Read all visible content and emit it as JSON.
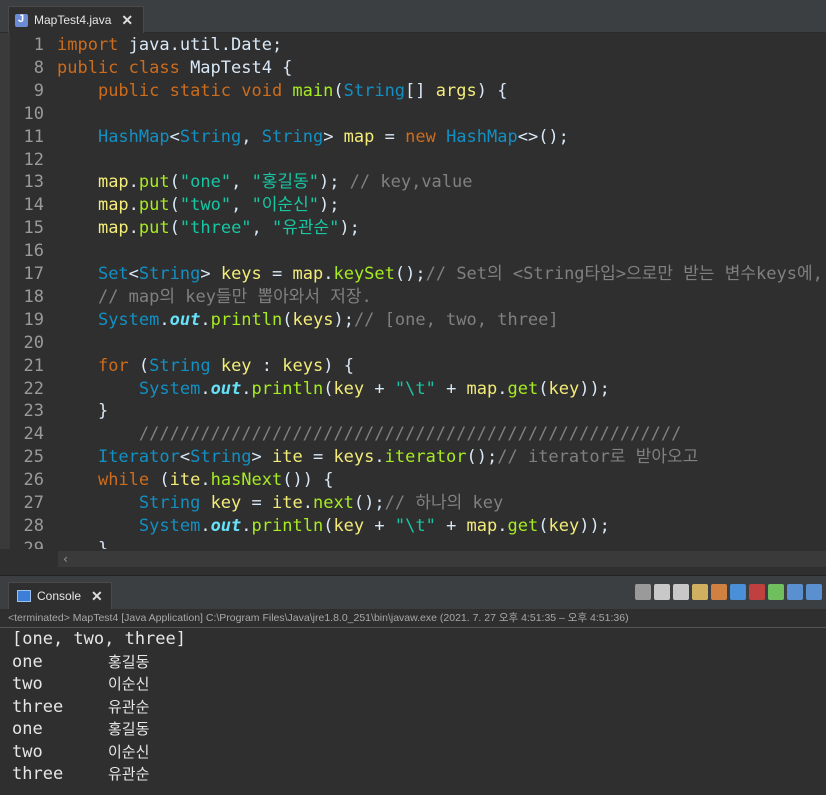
{
  "editor": {
    "tab_title": "MapTest4.java",
    "lines": [
      {
        "n": "1",
        "tokens": [
          {
            "c": "kw",
            "t": "import "
          },
          {
            "c": "",
            "t": "java.util.Date;"
          }
        ]
      },
      {
        "n": "8",
        "tokens": [
          {
            "c": "kw",
            "t": "public class "
          },
          {
            "c": "",
            "t": "MapTest4 {"
          }
        ]
      },
      {
        "n": "9",
        "tokens": [
          {
            "c": "",
            "t": "    "
          },
          {
            "c": "kw",
            "t": "public static void "
          },
          {
            "c": "fn",
            "t": "main"
          },
          {
            "c": "",
            "t": "("
          },
          {
            "c": "ty",
            "t": "String"
          },
          {
            "c": "",
            "t": "[] "
          },
          {
            "c": "vr",
            "t": "args"
          },
          {
            "c": "",
            "t": ") {"
          }
        ]
      },
      {
        "n": "10",
        "tokens": []
      },
      {
        "n": "11",
        "tokens": [
          {
            "c": "",
            "t": "    "
          },
          {
            "c": "ty",
            "t": "HashMap"
          },
          {
            "c": "",
            "t": "<"
          },
          {
            "c": "ty",
            "t": "String"
          },
          {
            "c": "",
            "t": ", "
          },
          {
            "c": "ty",
            "t": "String"
          },
          {
            "c": "",
            "t": "> "
          },
          {
            "c": "vr",
            "t": "map"
          },
          {
            "c": "",
            "t": " = "
          },
          {
            "c": "kw",
            "t": "new "
          },
          {
            "c": "ty",
            "t": "HashMap"
          },
          {
            "c": "",
            "t": "<>();"
          }
        ]
      },
      {
        "n": "12",
        "tokens": []
      },
      {
        "n": "13",
        "tokens": [
          {
            "c": "",
            "t": "    "
          },
          {
            "c": "vr",
            "t": "map"
          },
          {
            "c": "",
            "t": "."
          },
          {
            "c": "fn",
            "t": "put"
          },
          {
            "c": "",
            "t": "("
          },
          {
            "c": "str",
            "t": "\"one\""
          },
          {
            "c": "",
            "t": ", "
          },
          {
            "c": "str",
            "t": "\"홍길동\""
          },
          {
            "c": "",
            "t": "); "
          },
          {
            "c": "cm",
            "t": "// key,value"
          }
        ]
      },
      {
        "n": "14",
        "tokens": [
          {
            "c": "",
            "t": "    "
          },
          {
            "c": "vr",
            "t": "map"
          },
          {
            "c": "",
            "t": "."
          },
          {
            "c": "fn",
            "t": "put"
          },
          {
            "c": "",
            "t": "("
          },
          {
            "c": "str",
            "t": "\"two\""
          },
          {
            "c": "",
            "t": ", "
          },
          {
            "c": "str",
            "t": "\"이순신\""
          },
          {
            "c": "",
            "t": ");"
          }
        ]
      },
      {
        "n": "15",
        "tokens": [
          {
            "c": "",
            "t": "    "
          },
          {
            "c": "vr",
            "t": "map"
          },
          {
            "c": "",
            "t": "."
          },
          {
            "c": "fn",
            "t": "put"
          },
          {
            "c": "",
            "t": "("
          },
          {
            "c": "str",
            "t": "\"three\""
          },
          {
            "c": "",
            "t": ", "
          },
          {
            "c": "str",
            "t": "\"유관순\""
          },
          {
            "c": "",
            "t": ");"
          }
        ]
      },
      {
        "n": "16",
        "tokens": []
      },
      {
        "n": "17",
        "tokens": [
          {
            "c": "",
            "t": "    "
          },
          {
            "c": "ty",
            "t": "Set"
          },
          {
            "c": "",
            "t": "<"
          },
          {
            "c": "ty",
            "t": "String"
          },
          {
            "c": "",
            "t": "> "
          },
          {
            "c": "vr",
            "t": "keys"
          },
          {
            "c": "",
            "t": " = "
          },
          {
            "c": "vr",
            "t": "map"
          },
          {
            "c": "",
            "t": "."
          },
          {
            "c": "fn",
            "t": "keySet"
          },
          {
            "c": "",
            "t": "();"
          },
          {
            "c": "cm",
            "t": "// Set의 <String타입>으로만 받는 변수keys에,"
          }
        ]
      },
      {
        "n": "18",
        "tokens": [
          {
            "c": "",
            "t": "    "
          },
          {
            "c": "cm",
            "t": "// map의 key들만 뽑아와서 저장."
          }
        ]
      },
      {
        "n": "19",
        "tokens": [
          {
            "c": "",
            "t": "    "
          },
          {
            "c": "ty",
            "t": "System"
          },
          {
            "c": "",
            "t": "."
          },
          {
            "c": "fld",
            "t": "out"
          },
          {
            "c": "",
            "t": "."
          },
          {
            "c": "fn",
            "t": "println"
          },
          {
            "c": "",
            "t": "("
          },
          {
            "c": "vr",
            "t": "keys"
          },
          {
            "c": "",
            "t": ");"
          },
          {
            "c": "cm",
            "t": "// [one, two, three]"
          }
        ]
      },
      {
        "n": "20",
        "tokens": []
      },
      {
        "n": "21",
        "tokens": [
          {
            "c": "",
            "t": "    "
          },
          {
            "c": "kw",
            "t": "for "
          },
          {
            "c": "",
            "t": "("
          },
          {
            "c": "ty",
            "t": "String"
          },
          {
            "c": "",
            "t": " "
          },
          {
            "c": "vr",
            "t": "key"
          },
          {
            "c": "",
            "t": " : "
          },
          {
            "c": "vr",
            "t": "keys"
          },
          {
            "c": "",
            "t": ") {"
          }
        ]
      },
      {
        "n": "22",
        "tokens": [
          {
            "c": "",
            "t": "        "
          },
          {
            "c": "ty",
            "t": "System"
          },
          {
            "c": "",
            "t": "."
          },
          {
            "c": "fld",
            "t": "out"
          },
          {
            "c": "",
            "t": "."
          },
          {
            "c": "fn",
            "t": "println"
          },
          {
            "c": "",
            "t": "("
          },
          {
            "c": "vr",
            "t": "key"
          },
          {
            "c": "",
            "t": " + "
          },
          {
            "c": "str",
            "t": "\"\\t\""
          },
          {
            "c": "",
            "t": " + "
          },
          {
            "c": "vr",
            "t": "map"
          },
          {
            "c": "",
            "t": "."
          },
          {
            "c": "fn",
            "t": "get"
          },
          {
            "c": "",
            "t": "("
          },
          {
            "c": "vr",
            "t": "key"
          },
          {
            "c": "",
            "t": "));"
          }
        ]
      },
      {
        "n": "23",
        "tokens": [
          {
            "c": "",
            "t": "    }"
          }
        ]
      },
      {
        "n": "24",
        "tokens": [
          {
            "c": "",
            "t": "        "
          },
          {
            "c": "cm",
            "t": "/////////////////////////////////////////////////////"
          }
        ]
      },
      {
        "n": "25",
        "tokens": [
          {
            "c": "",
            "t": "    "
          },
          {
            "c": "ty",
            "t": "Iterator"
          },
          {
            "c": "",
            "t": "<"
          },
          {
            "c": "ty",
            "t": "String"
          },
          {
            "c": "",
            "t": "> "
          },
          {
            "c": "vr",
            "t": "ite"
          },
          {
            "c": "",
            "t": " = "
          },
          {
            "c": "vr",
            "t": "keys"
          },
          {
            "c": "",
            "t": "."
          },
          {
            "c": "fn",
            "t": "iterator"
          },
          {
            "c": "",
            "t": "();"
          },
          {
            "c": "cm",
            "t": "// iterator로 받아오고"
          }
        ]
      },
      {
        "n": "26",
        "tokens": [
          {
            "c": "",
            "t": "    "
          },
          {
            "c": "kw",
            "t": "while "
          },
          {
            "c": "",
            "t": "("
          },
          {
            "c": "vr",
            "t": "ite"
          },
          {
            "c": "",
            "t": "."
          },
          {
            "c": "fn",
            "t": "hasNext"
          },
          {
            "c": "",
            "t": "()) {"
          }
        ]
      },
      {
        "n": "27",
        "tokens": [
          {
            "c": "",
            "t": "        "
          },
          {
            "c": "ty",
            "t": "String"
          },
          {
            "c": "",
            "t": " "
          },
          {
            "c": "vr",
            "t": "key"
          },
          {
            "c": "",
            "t": " = "
          },
          {
            "c": "vr",
            "t": "ite"
          },
          {
            "c": "",
            "t": "."
          },
          {
            "c": "fn",
            "t": "next"
          },
          {
            "c": "",
            "t": "();"
          },
          {
            "c": "cm",
            "t": "// 하나의 key"
          }
        ]
      },
      {
        "n": "28",
        "tokens": [
          {
            "c": "",
            "t": "        "
          },
          {
            "c": "ty",
            "t": "System"
          },
          {
            "c": "",
            "t": "."
          },
          {
            "c": "fld",
            "t": "out"
          },
          {
            "c": "",
            "t": "."
          },
          {
            "c": "fn",
            "t": "println"
          },
          {
            "c": "",
            "t": "("
          },
          {
            "c": "vr",
            "t": "key"
          },
          {
            "c": "",
            "t": " + "
          },
          {
            "c": "str",
            "t": "\"\\t\""
          },
          {
            "c": "",
            "t": " + "
          },
          {
            "c": "vr",
            "t": "map"
          },
          {
            "c": "",
            "t": "."
          },
          {
            "c": "fn",
            "t": "get"
          },
          {
            "c": "",
            "t": "("
          },
          {
            "c": "vr",
            "t": "key"
          },
          {
            "c": "",
            "t": "));"
          }
        ]
      },
      {
        "n": "29",
        "tokens": [
          {
            "c": "",
            "t": "    }"
          }
        ]
      }
    ]
  },
  "console": {
    "tab_title": "Console",
    "status": "<terminated> MapTest4 [Java Application] C:\\Program Files\\Java\\jre1.8.0_251\\bin\\javaw.exe  (2021. 7. 27 오후 4:51:35 – 오후 4:51:36)",
    "first_line": "[one, two, three]",
    "rows": [
      {
        "key": "one",
        "val": "홍길동"
      },
      {
        "key": "two",
        "val": "이순신"
      },
      {
        "key": "three",
        "val": "유관순"
      },
      {
        "key": "one",
        "val": "홍길동"
      },
      {
        "key": "two",
        "val": "이순신"
      },
      {
        "key": "three",
        "val": "유관순"
      }
    ],
    "toolbar_icons": [
      "terminate-icon",
      "remove-launch-icon",
      "remove-all-icon",
      "scroll-lock-icon",
      "word-wrap-icon",
      "show-on-output-icon",
      "show-on-error-icon",
      "pin-console-icon",
      "display-console-icon",
      "open-console-icon"
    ]
  },
  "colors": {
    "background": "#2f2f2f",
    "keyword": "#cc6c1d",
    "type": "#1290c3",
    "string": "#17c6a3",
    "comment": "#808080"
  }
}
